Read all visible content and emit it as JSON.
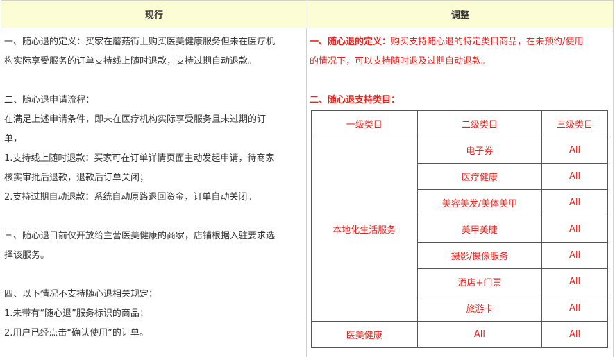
{
  "headers": {
    "current": "现行",
    "adjusted": "调整"
  },
  "left_lines": [
    "一、随心退的定义：买家在蘑菇街上购买医美健康服务但未在医疗机",
    "构实际享受服务的订单支持线上随时退款，支持过期自动退款。",
    "二、随心退申请流程：",
    "在满足上述申请条件，即未在医疗机构实际享受服务且未过期的订",
    "单，",
    "1.支持线上随时退款：买家可在订单详情页面主动发起申请，待商家",
    "核实审批后退款，退款后订单关闭；",
    "2.支持过期自动退款：系统自动原路退回资金，订单自动关闭。",
    "三、随心退目前仅开放给主营医美健康的商家，店铺根据入驻要求选",
    "择该服务。",
    "四、以下情况不支持随心退相关规定：",
    "1.未带有“随心退”服务标识的商品；",
    "2.用户已经点击“确认使用”的订单。"
  ],
  "right": {
    "def_title": "一、随心退的定义：",
    "def_text_1": "购买支持随心退的特定类目商品，在未预约/使用",
    "def_text_2": "的情况下，可以支持随时退及过期自动退款。",
    "cat_title": "二、随心退支持类目："
  },
  "table": {
    "headers": [
      "一级类目",
      "二级类目",
      "三级类目"
    ],
    "group1": "本地化生活服务",
    "group1_rows": [
      [
        "电子券",
        "All"
      ],
      [
        "医疗健康",
        "All"
      ],
      [
        "美容美发/美体美甲",
        "All"
      ],
      [
        "美甲美睫",
        "All"
      ],
      [
        "摄影/摄像服务",
        "All"
      ],
      [
        "酒店+门票",
        "All"
      ],
      [
        "旅游卡",
        "All"
      ]
    ],
    "group2_row": [
      "医美健康",
      "All",
      "All"
    ]
  }
}
